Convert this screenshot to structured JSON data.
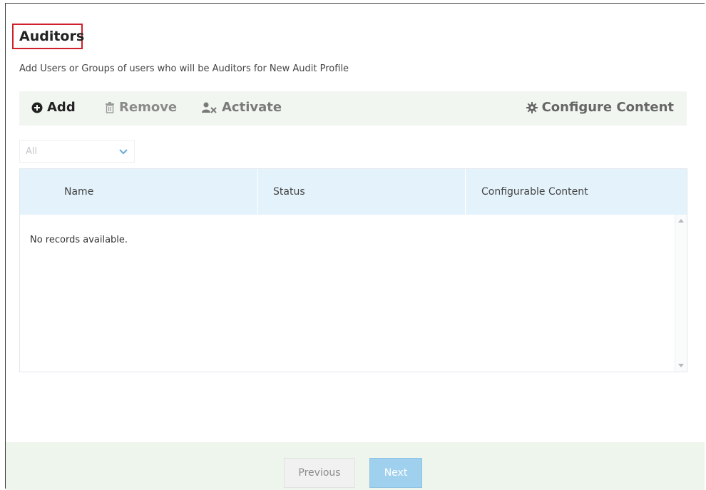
{
  "header": {
    "title": "Auditors",
    "subtitle": "Add Users or Groups of users who will be Auditors for New Audit Profile"
  },
  "toolbar": {
    "add_label": "Add",
    "remove_label": "Remove",
    "activate_label": "Activate",
    "configure_label": "Configure Content",
    "icons": {
      "add": "plus-circle-icon",
      "remove": "trash-icon",
      "activate": "user-x-icon",
      "configure": "gear-icon"
    }
  },
  "filter": {
    "selected": "All"
  },
  "grid": {
    "columns": [
      "Name",
      "Status",
      "Configurable Content"
    ],
    "empty_message": "No records available.",
    "rows": []
  },
  "footer": {
    "previous_label": "Previous",
    "next_label": "Next"
  },
  "colors": {
    "highlight_border": "#d0202a",
    "grid_header": "#e4f2fb",
    "toolbar_bg": "#f2f6f1",
    "next_button": "#9fd0ee"
  }
}
